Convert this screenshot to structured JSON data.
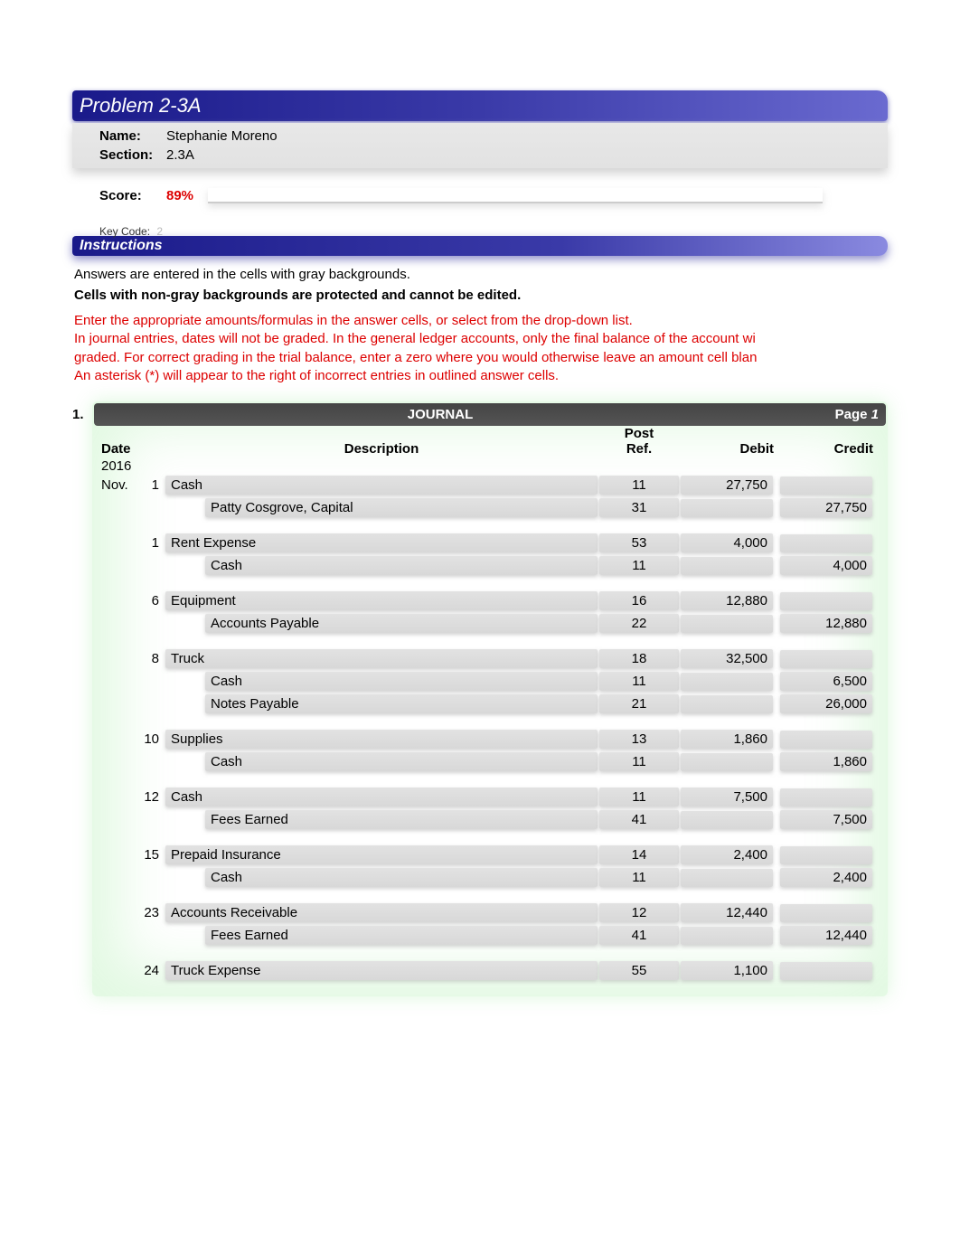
{
  "problem_title": "Problem 2-3A",
  "info": {
    "name_label": "Name:",
    "name_value": "Stephanie Moreno",
    "section_label": "Section:",
    "section_value": "2.3A",
    "score_label": "Score:",
    "score_value": "89%",
    "keycode_label": "Key Code:",
    "keycode_value": "2"
  },
  "instructions_title": "Instructions",
  "instructions": {
    "line1": "Answers are entered in the cells with gray backgrounds.",
    "line2": "Cells with non-gray backgrounds are protected and cannot be edited.",
    "red": "Enter the appropriate amounts/formulas in the answer cells, or select from the drop-down list.\nIn journal entries, dates will not be graded. In the general ledger accounts, only the final balance of the account wi\ngraded. For correct grading in the trial balance, enter a zero where you would otherwise leave an amount cell blan\nAn asterisk (*) will appear to the right of incorrect entries in outlined answer cells."
  },
  "section_number": "1.",
  "journal": {
    "title": "JOURNAL",
    "page_label": "Page",
    "page_num": "1",
    "cols": {
      "date": "Date",
      "desc": "Description",
      "post": "Post",
      "ref": "Ref.",
      "debit": "Debit",
      "credit": "Credit"
    },
    "year": "2016",
    "month": "Nov.",
    "entries": [
      {
        "day": "1",
        "lines": [
          {
            "desc": "Cash",
            "ref": "11",
            "debit": "27,750",
            "credit": "",
            "indent": false
          },
          {
            "desc": "Patty Cosgrove, Capital",
            "ref": "31",
            "debit": "",
            "credit": "27,750",
            "indent": true
          }
        ]
      },
      {
        "day": "1",
        "lines": [
          {
            "desc": "Rent Expense",
            "ref": "53",
            "debit": "4,000",
            "credit": "",
            "indent": false
          },
          {
            "desc": "Cash",
            "ref": "11",
            "debit": "",
            "credit": "4,000",
            "indent": true
          }
        ]
      },
      {
        "day": "6",
        "lines": [
          {
            "desc": "Equipment",
            "ref": "16",
            "debit": "12,880",
            "credit": "",
            "indent": false
          },
          {
            "desc": "Accounts Payable",
            "ref": "22",
            "debit": "",
            "credit": "12,880",
            "indent": true
          }
        ]
      },
      {
        "day": "8",
        "lines": [
          {
            "desc": "Truck",
            "ref": "18",
            "debit": "32,500",
            "credit": "",
            "indent": false
          },
          {
            "desc": "Cash",
            "ref": "11",
            "debit": "",
            "credit": "6,500",
            "indent": true
          },
          {
            "desc": "Notes Payable",
            "ref": "21",
            "debit": "",
            "credit": "26,000",
            "indent": true
          }
        ]
      },
      {
        "day": "10",
        "lines": [
          {
            "desc": "Supplies",
            "ref": "13",
            "debit": "1,860",
            "credit": "",
            "indent": false
          },
          {
            "desc": "Cash",
            "ref": "11",
            "debit": "",
            "credit": "1,860",
            "indent": true
          }
        ]
      },
      {
        "day": "12",
        "lines": [
          {
            "desc": "Cash",
            "ref": "11",
            "debit": "7,500",
            "credit": "",
            "indent": false
          },
          {
            "desc": "Fees Earned",
            "ref": "41",
            "debit": "",
            "credit": "7,500",
            "indent": true
          }
        ]
      },
      {
        "day": "15",
        "lines": [
          {
            "desc": "Prepaid Insurance",
            "ref": "14",
            "debit": "2,400",
            "credit": "",
            "indent": false
          },
          {
            "desc": "Cash",
            "ref": "11",
            "debit": "",
            "credit": "2,400",
            "indent": true
          }
        ]
      },
      {
        "day": "23",
        "lines": [
          {
            "desc": "Accounts Receivable",
            "ref": "12",
            "debit": "12,440",
            "credit": "",
            "indent": false
          },
          {
            "desc": "Fees Earned",
            "ref": "41",
            "debit": "",
            "credit": "12,440",
            "indent": true
          }
        ]
      },
      {
        "day": "24",
        "lines": [
          {
            "desc": "Truck Expense",
            "ref": "55",
            "debit": "1,100",
            "credit": "",
            "indent": false
          }
        ]
      }
    ]
  }
}
